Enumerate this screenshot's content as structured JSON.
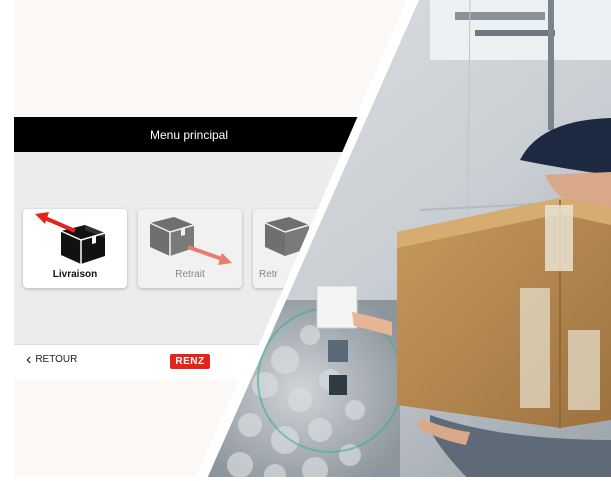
{
  "header": {
    "title": "Menu principal"
  },
  "tiles": [
    {
      "label": "Livraison",
      "icon": "box-with-arrow-out-icon",
      "state": "active"
    },
    {
      "label": "Retrait",
      "icon": "box-with-arrow-down-icon",
      "state": "disabled"
    },
    {
      "label": "Retr",
      "icon": "box-icon",
      "state": "disabled"
    }
  ],
  "footer": {
    "back_label": "RETOUR",
    "back_icon": "chevron-left-icon",
    "logo_text": "RENZ"
  },
  "colors": {
    "accent_red": "#e2241b",
    "title_bar": "#000000",
    "menu_bg": "#ececec"
  }
}
